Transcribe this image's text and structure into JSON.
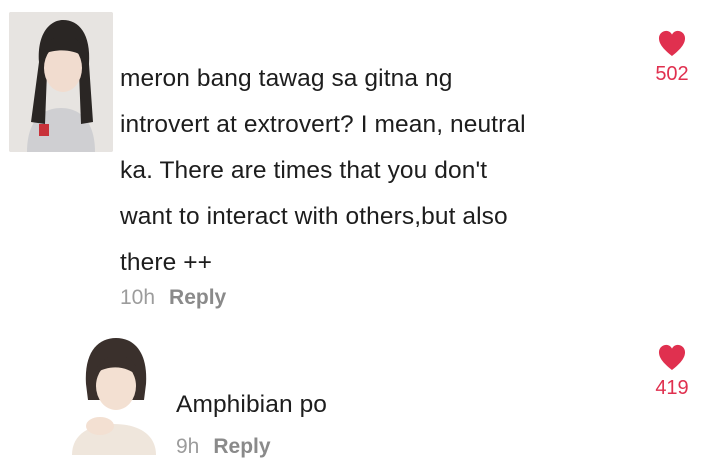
{
  "colors": {
    "accent": "#e0304f",
    "meta": "#9c9c9c"
  },
  "comments": [
    {
      "avatar_icon": "user-avatar",
      "text": "meron bang tawag sa gitna ng\nintrovert at extrovert? I mean, neutral\nka. There are times that you don't\nwant to interact with others,but also\nthere ++",
      "time": "10h",
      "reply_label": "Reply",
      "likes": "502",
      "like_icon": "heart-icon"
    },
    {
      "avatar_icon": "user-avatar",
      "text": "Amphibian po",
      "time": "9h",
      "reply_label": "Reply",
      "likes": "419",
      "like_icon": "heart-icon"
    }
  ]
}
